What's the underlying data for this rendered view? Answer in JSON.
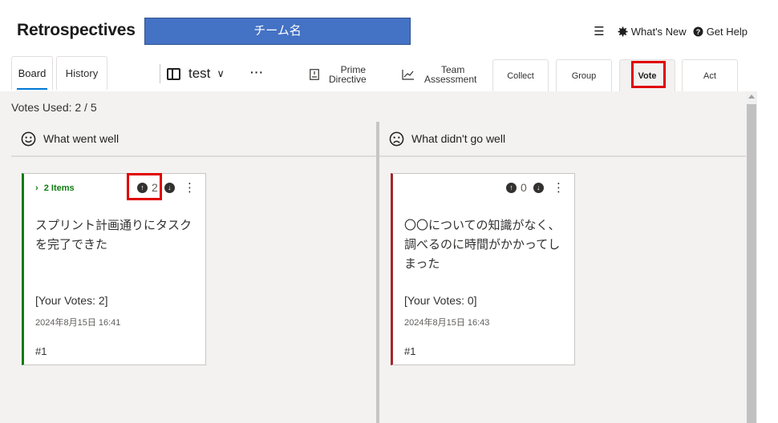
{
  "app": {
    "title": "Retrospectives"
  },
  "team_banner": {
    "text": "チーム名",
    "color": "#4472c4"
  },
  "header_links": {
    "menu_icon": "hamburger-icon",
    "whats_new": "What's New",
    "get_help": "Get Help"
  },
  "tabs": [
    {
      "label": "Board",
      "active": true
    },
    {
      "label": "History",
      "active": false
    }
  ],
  "board_selector": {
    "name": "test",
    "icon": "board-icon"
  },
  "toolbar": {
    "more": "···",
    "prime_directive": {
      "line1": "Prime",
      "line2": "Directive",
      "icon": "document-icon"
    },
    "team_assessment": {
      "line1": "Team",
      "line2": "Assessment",
      "icon": "chart-line-icon"
    }
  },
  "stages": [
    {
      "label": "Collect",
      "active": false
    },
    {
      "label": "Group",
      "active": false
    },
    {
      "label": "Vote",
      "active": true
    },
    {
      "label": "Act",
      "active": false
    }
  ],
  "votes_used": "Votes Used: 2 / 5",
  "columns": [
    {
      "title": "What went well",
      "icon": "smile-icon",
      "accent": "#107c10",
      "cards": [
        {
          "group_label": "2 Items",
          "upvotes": "2",
          "text": "スプリント計画通りにタスクを完了できた",
          "your_votes": "[Your Votes: 2]",
          "date": "2024年8月15日 16:41",
          "number": "#1"
        }
      ]
    },
    {
      "title": "What didn't go well",
      "icon": "frown-icon",
      "accent": "#a4262c",
      "cards": [
        {
          "upvotes": "0",
          "text": "〇〇についての知識がなく、調べるのに時間がかかってしまった",
          "your_votes": "[Your Votes: 0]",
          "date": "2024年8月15日 16:43",
          "number": "#1"
        }
      ]
    }
  ],
  "highlight_color": "#e00000"
}
